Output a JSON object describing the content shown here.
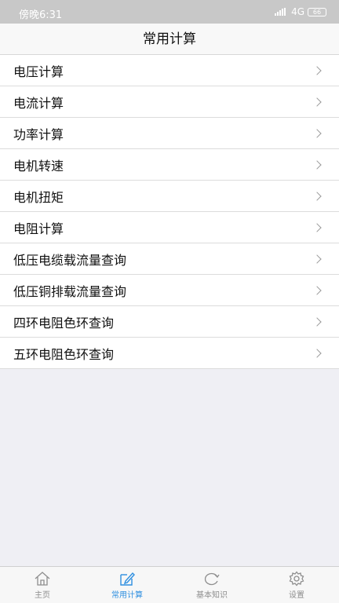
{
  "status_bar": {
    "time": "傍晚6:31",
    "network": "4G",
    "battery": "66"
  },
  "header": {
    "title": "常用计算"
  },
  "menu": {
    "items": [
      {
        "label": "电压计算"
      },
      {
        "label": "电流计算"
      },
      {
        "label": "功率计算"
      },
      {
        "label": "电机转速"
      },
      {
        "label": "电机扭矩"
      },
      {
        "label": "电阻计算"
      },
      {
        "label": "低压电缆载流量查询"
      },
      {
        "label": "低压铜排载流量查询"
      },
      {
        "label": "四环电阻色环查询"
      },
      {
        "label": "五环电阻色环查询"
      }
    ]
  },
  "tab_bar": {
    "tabs": [
      {
        "label": "主页",
        "icon": "home-icon"
      },
      {
        "label": "常用计算",
        "icon": "edit-icon",
        "active": true
      },
      {
        "label": "基本知识",
        "icon": "refresh-icon"
      },
      {
        "label": "设置",
        "icon": "gear-icon"
      }
    ],
    "active_color": "#2e8fe0",
    "inactive_color": "#8e8e8e"
  }
}
